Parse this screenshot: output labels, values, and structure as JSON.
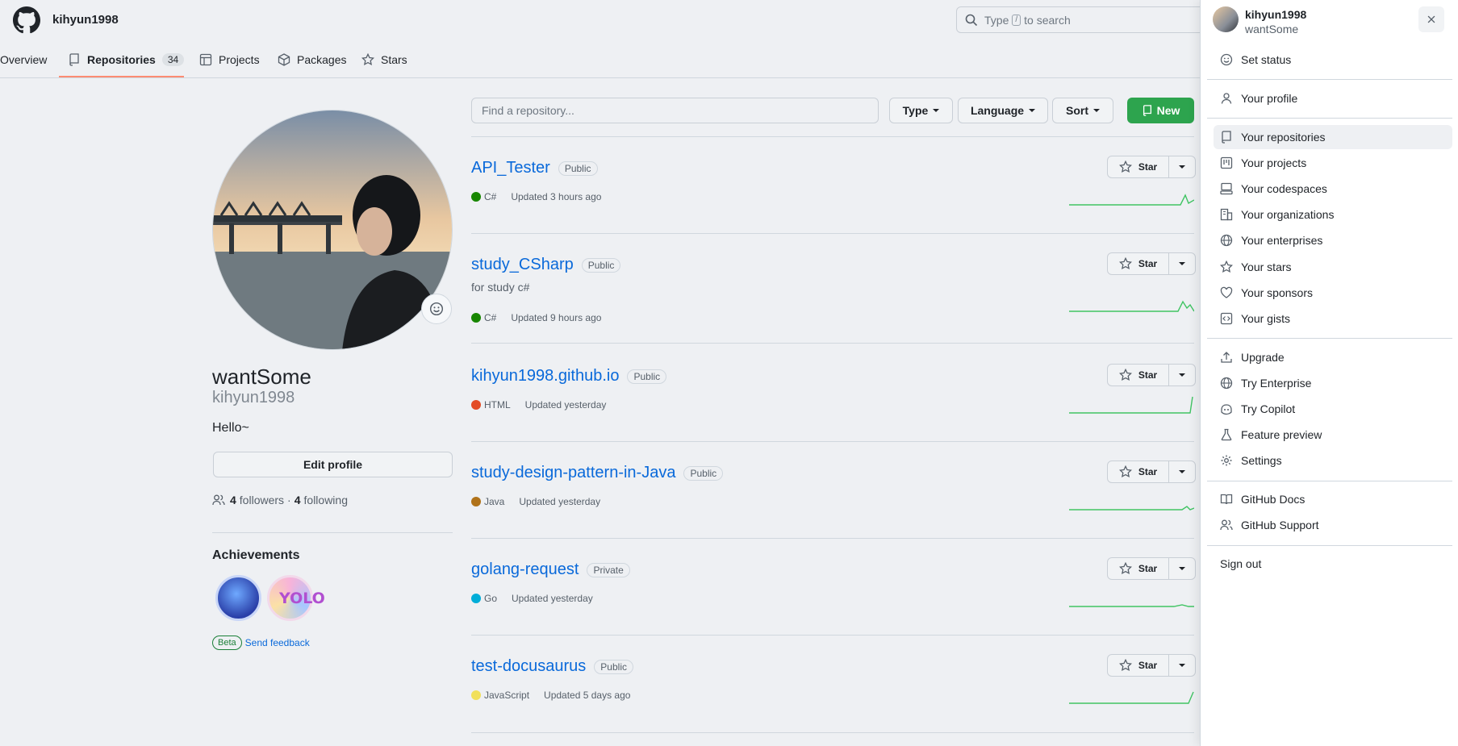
{
  "header": {
    "username": "kihyun1998",
    "search_prefix": "Type",
    "search_key": "/",
    "search_suffix": "to search"
  },
  "tabs": [
    {
      "label": "Overview"
    },
    {
      "label": "Repositories",
      "count": "34"
    },
    {
      "label": "Projects"
    },
    {
      "label": "Packages"
    },
    {
      "label": "Stars"
    }
  ],
  "profile": {
    "name": "wantSome",
    "login": "kihyun1998",
    "bio": "Hello~",
    "edit_label": "Edit profile",
    "followers_count": "4",
    "followers_label": "followers",
    "separator": "·",
    "following_count": "4",
    "following_label": "following",
    "achievements_title": "Achievements",
    "beta_label": "Beta",
    "feedback_label": "Send feedback",
    "achievement2_text": "YOLO"
  },
  "filters": {
    "find_placeholder": "Find a repository...",
    "type_label": "Type",
    "language_label": "Language",
    "sort_label": "Sort",
    "new_label": "New"
  },
  "repos": [
    {
      "name": "API_Tester",
      "visibility": "Public",
      "description": "",
      "language": "C#",
      "lang_color": "#178600",
      "updated": "Updated 3 hours ago",
      "star_label": "Star"
    },
    {
      "name": "study_CSharp",
      "visibility": "Public",
      "description": "for study c#",
      "language": "C#",
      "lang_color": "#178600",
      "updated": "Updated 9 hours ago",
      "star_label": "Star"
    },
    {
      "name": "kihyun1998.github.io",
      "visibility": "Public",
      "description": "",
      "language": "HTML",
      "lang_color": "#e34c26",
      "updated": "Updated yesterday",
      "star_label": "Star"
    },
    {
      "name": "study-design-pattern-in-Java",
      "visibility": "Public",
      "description": "",
      "language": "Java",
      "lang_color": "#b07219",
      "updated": "Updated yesterday",
      "star_label": "Star"
    },
    {
      "name": "golang-request",
      "visibility": "Private",
      "description": "",
      "language": "Go",
      "lang_color": "#00ADD8",
      "updated": "Updated yesterday",
      "star_label": "Star"
    },
    {
      "name": "test-docusaurus",
      "visibility": "Public",
      "description": "",
      "language": "JavaScript",
      "lang_color": "#f1e05a",
      "updated": "Updated 5 days ago",
      "star_label": "Star"
    }
  ],
  "panel": {
    "login": "kihyun1998",
    "name": "wantSome",
    "items": [
      {
        "label": "Set status",
        "icon": "smiley-icon"
      },
      {
        "label": "Your profile",
        "icon": "person-icon"
      },
      {
        "label": "Your repositories",
        "icon": "repo-icon"
      },
      {
        "label": "Your projects",
        "icon": "project-icon"
      },
      {
        "label": "Your codespaces",
        "icon": "codespaces-icon"
      },
      {
        "label": "Your organizations",
        "icon": "organization-icon"
      },
      {
        "label": "Your enterprises",
        "icon": "globe-icon"
      },
      {
        "label": "Your stars",
        "icon": "star-icon"
      },
      {
        "label": "Your sponsors",
        "icon": "heart-icon"
      },
      {
        "label": "Your gists",
        "icon": "code-square-icon"
      },
      {
        "label": "Upgrade",
        "icon": "upload-icon"
      },
      {
        "label": "Try Enterprise",
        "icon": "globe-icon"
      },
      {
        "label": "Try Copilot",
        "icon": "copilot-icon"
      },
      {
        "label": "Feature preview",
        "icon": "beaker-icon"
      },
      {
        "label": "Settings",
        "icon": "gear-icon"
      },
      {
        "label": "GitHub Docs",
        "icon": "book-icon"
      },
      {
        "label": "GitHub Support",
        "icon": "people-icon"
      },
      {
        "label": "Sign out",
        "icon": ""
      }
    ]
  },
  "colors": {
    "accent_green": "#2da44e",
    "link_blue": "#0969da",
    "tab_underline": "#fd8c73"
  }
}
